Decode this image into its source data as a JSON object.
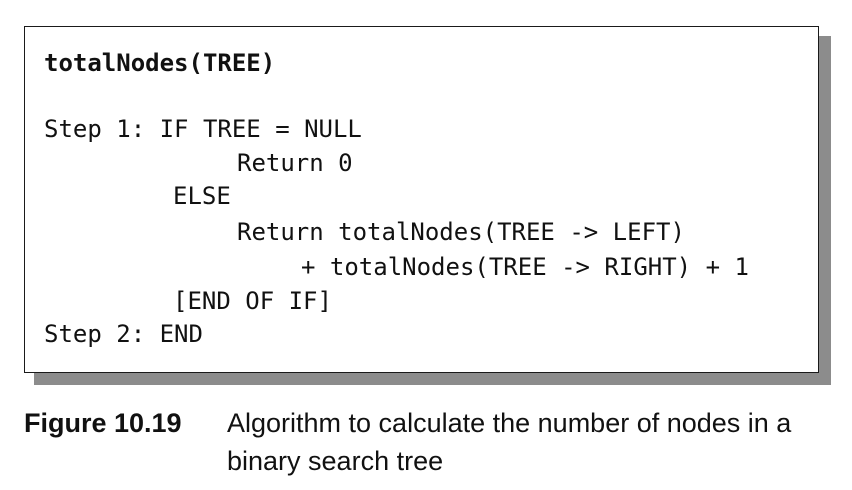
{
  "algorithm": {
    "title": "totalNodes(TREE)",
    "lines": [
      "Step 1: IF TREE = NULL",
      "Return 0",
      "ELSE",
      "Return totalNodes(TREE -> LEFT)",
      "+ totalNodes(TREE -> RIGHT) + 1",
      "[END OF IF]",
      "Step 2: END"
    ]
  },
  "caption": {
    "label": "Figure 10.19",
    "text": "Algorithm to calculate the number of nodes in a binary search tree"
  }
}
